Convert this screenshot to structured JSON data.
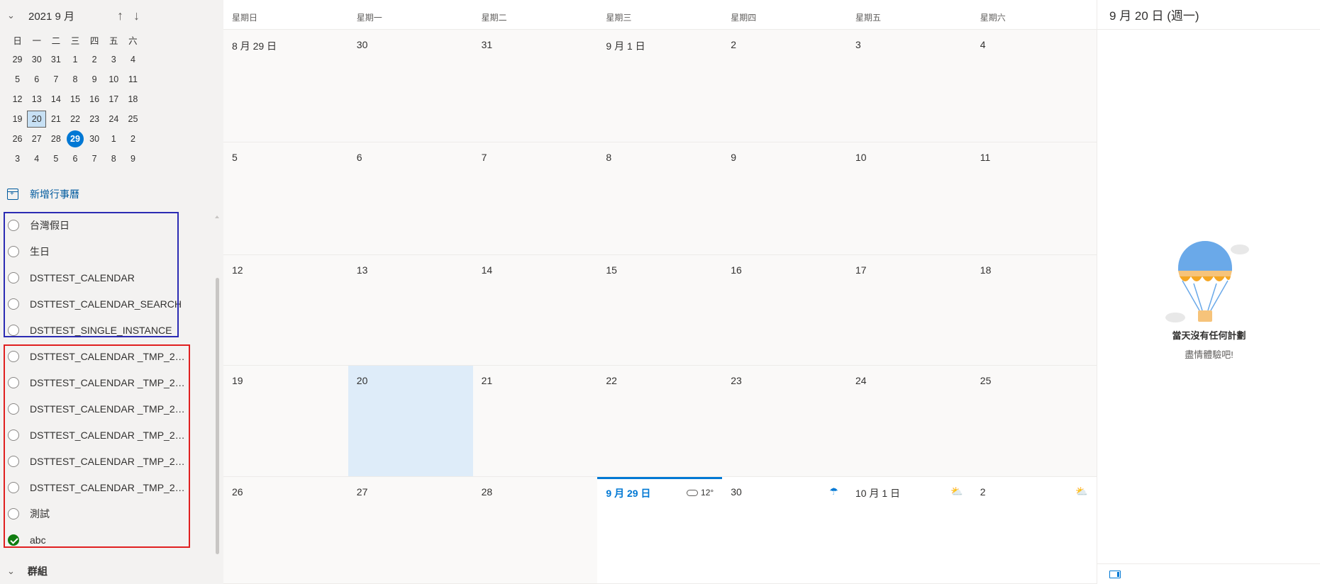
{
  "mini_calendar": {
    "title": "2021 9 月",
    "weekdays": [
      "日",
      "一",
      "二",
      "三",
      "四",
      "五",
      "六"
    ],
    "weeks": [
      [
        "29",
        "30",
        "31",
        "1",
        "2",
        "3",
        "4"
      ],
      [
        "5",
        "6",
        "7",
        "8",
        "9",
        "10",
        "11"
      ],
      [
        "12",
        "13",
        "14",
        "15",
        "16",
        "17",
        "18"
      ],
      [
        "19",
        "20",
        "21",
        "22",
        "23",
        "24",
        "25"
      ],
      [
        "26",
        "27",
        "28",
        "29",
        "30",
        "1",
        "2"
      ],
      [
        "3",
        "4",
        "5",
        "6",
        "7",
        "8",
        "9"
      ]
    ],
    "selected": "20",
    "today": "29"
  },
  "add_calendar_label": "新增行事曆",
  "calendars": [
    {
      "label": "台灣假日",
      "checked": false
    },
    {
      "label": "生日",
      "checked": false
    },
    {
      "label": "DSTTEST_CALENDAR",
      "checked": false
    },
    {
      "label": "DSTTEST_CALENDAR_SEARCH",
      "checked": false
    },
    {
      "label": "DSTTEST_SINGLE_INSTANCE",
      "checked": false
    },
    {
      "label": "DSTTEST_CALENDAR _TMP_202...",
      "checked": false
    },
    {
      "label": "DSTTEST_CALENDAR _TMP_202...",
      "checked": false
    },
    {
      "label": "DSTTEST_CALENDAR _TMP_202...",
      "checked": false
    },
    {
      "label": "DSTTEST_CALENDAR _TMP_202...",
      "checked": false
    },
    {
      "label": "DSTTEST_CALENDAR _TMP_202...",
      "checked": false
    },
    {
      "label": "DSTTEST_CALENDAR _TMP_202...",
      "checked": false
    },
    {
      "label": "測試",
      "checked": false
    },
    {
      "label": "abc",
      "checked": true
    }
  ],
  "groups_label": "群組",
  "month": {
    "weekday_headers": [
      "星期日",
      "星期一",
      "星期二",
      "星期三",
      "星期四",
      "星期五",
      "星期六"
    ],
    "weeks": [
      [
        "8 月 29 日",
        "30",
        "31",
        "9 月 1 日",
        "2",
        "3",
        "4"
      ],
      [
        "5",
        "6",
        "7",
        "8",
        "9",
        "10",
        "11"
      ],
      [
        "12",
        "13",
        "14",
        "15",
        "16",
        "17",
        "18"
      ],
      [
        "19",
        "20",
        "21",
        "22",
        "23",
        "24",
        "25"
      ],
      [
        "26",
        "27",
        "28",
        "9 月 29 日",
        "30",
        "10 月 1 日",
        "2"
      ]
    ],
    "selected_label": "20",
    "today_label": "9 月 29 日",
    "weather": {
      "9 月 29 日": {
        "icon": "cloud-icon",
        "temp": "12°"
      },
      "30": {
        "icon": "rain-cloud-icon",
        "temp": ""
      },
      "10 月 1 日": {
        "icon": "partly-sunny-icon",
        "temp": ""
      },
      "2": {
        "icon": "partly-sunny-icon",
        "temp": ""
      }
    }
  },
  "agenda": {
    "title": "9 月 20 日 (週一)",
    "empty_title": "當天沒有任何計劃",
    "empty_subtitle": "盡情體驗吧!"
  },
  "colors": {
    "accent": "#0078d4",
    "selected_day": "#deecf9",
    "check_green": "#107c10",
    "highlight_blue_box": "#2b2bb3",
    "highlight_red_box": "#e02020"
  }
}
